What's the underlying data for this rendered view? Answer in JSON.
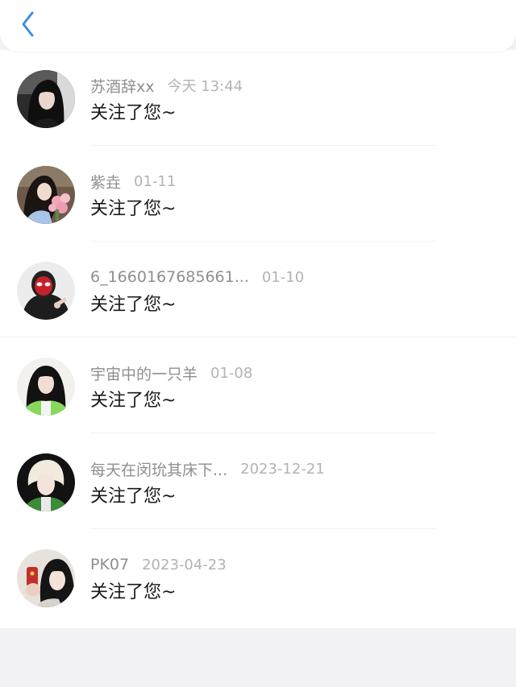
{
  "header": {
    "back_icon": "chevron-left-icon",
    "accent_color": "#3d8fe0"
  },
  "notifications": [
    {
      "name": "苏酒辞xx",
      "time": "今天 13:44",
      "message": "关注了您~",
      "avatar": "avatar-girl-black-hair"
    },
    {
      "name": "紫垚",
      "time": "01-11",
      "message": "关注了您~",
      "avatar": "avatar-girl-flowers"
    },
    {
      "name": "6_1660167685661...",
      "time": "01-10",
      "message": "关注了您~",
      "avatar": "avatar-spiderman-mask"
    },
    {
      "name": "宇宙中的一只羊",
      "time": "01-08",
      "message": "关注了您~",
      "avatar": "avatar-girl-green-top"
    },
    {
      "name": "每天在闵玧其床下...",
      "time": "2023-12-21",
      "message": "关注了您~",
      "avatar": "avatar-blond-boy"
    },
    {
      "name": "PK07",
      "time": "2023-04-23",
      "message": "关注了您~",
      "avatar": "avatar-girl-phone"
    }
  ]
}
